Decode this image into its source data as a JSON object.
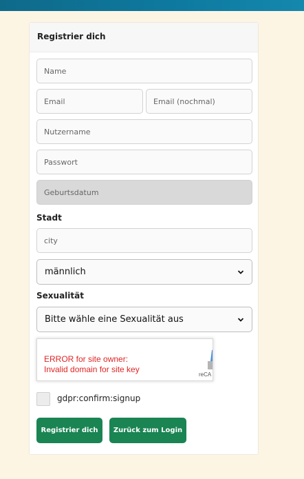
{
  "form": {
    "title": "Registrier dich",
    "name_placeholder": "Name",
    "email_placeholder": "Email",
    "email_confirm_placeholder": "Email (nochmal)",
    "username_placeholder": "Nutzername",
    "password_placeholder": "Passwort",
    "birthdate_placeholder": "Geburtsdatum",
    "city_label": "Stadt",
    "city_placeholder": "city",
    "gender_selected": "männlich",
    "sexuality_label": "Sexualität",
    "sexuality_selected": "Bitte wähle eine Sexualität aus",
    "captcha": {
      "error_line1": "ERROR for site owner:",
      "error_line2": "Invalid domain for site key",
      "brand": "reCA"
    },
    "gdpr_label": "gdpr:confirm:signup",
    "register_button": "Registrier dich",
    "back_button": "Zurück zum Login"
  },
  "colors": {
    "page_background": "#fdf5e4",
    "topbar": "#0e7aa0",
    "primary_button": "#1a8453",
    "captcha_error": "#e02424"
  }
}
